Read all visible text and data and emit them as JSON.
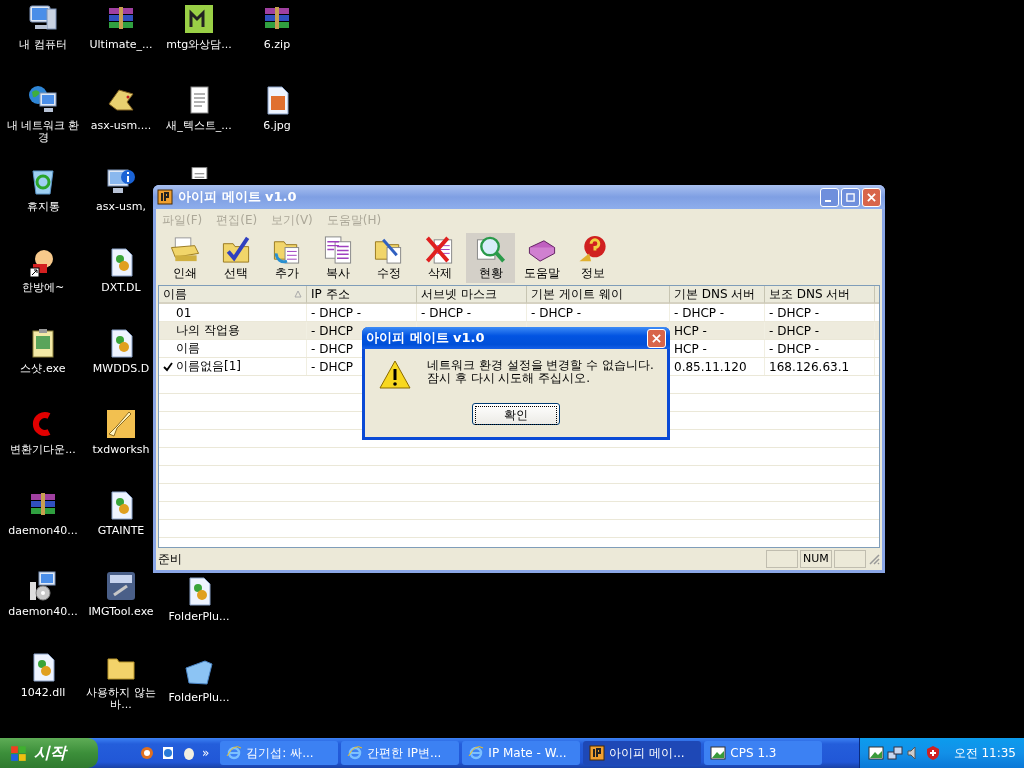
{
  "desktop": {
    "columns": [
      {
        "groups": [
          [
            {
              "label": "내 컴퓨터",
              "kind": "computer"
            },
            {
              "label": "내 네트워크 환경",
              "kind": "network"
            },
            {
              "label": "휴지통",
              "kind": "recycle"
            },
            {
              "label": "한방에~",
              "kind": "character"
            },
            {
              "label": "스샷.exe",
              "kind": "clipboard"
            },
            {
              "label": "변환기다운...",
              "kind": "letter"
            },
            {
              "label": "daemon40...",
              "kind": "archive"
            },
            {
              "label": "daemon40...",
              "kind": "installer"
            },
            {
              "label": "1042.dll",
              "kind": "dll"
            }
          ]
        ]
      },
      {
        "groups": [
          [
            {
              "label": "Ultimate_...",
              "kind": "archive"
            },
            {
              "label": "asx-usm....",
              "kind": "creature"
            },
            {
              "label": "asx-usm,",
              "kind": "info"
            },
            {
              "label": "DXT.DL",
              "kind": "dll"
            },
            {
              "label": "MWDDS.D",
              "kind": "dll"
            },
            {
              "label": "txdworksh",
              "kind": "brush"
            },
            {
              "label": "GTAINTE",
              "kind": "dll"
            },
            {
              "label": "IMGTool.exe",
              "kind": "tool"
            },
            {
              "label": "사용하지 않는 바...",
              "kind": "folder"
            }
          ]
        ]
      },
      {
        "groups": [
          [
            {
              "label": "mtg와상담...",
              "kind": "app"
            },
            {
              "label": "새_텍스트_...",
              "kind": "text"
            },
            {
              "kind": "text"
            }
          ],
          [
            {
              "label": "FolderPlu...",
              "kind": "dll"
            },
            {
              "label": "FolderPlu...",
              "kind": "bluefolder"
            }
          ]
        ]
      },
      {
        "groups": [
          [
            {
              "label": "6.zip",
              "kind": "archive"
            },
            {
              "label": "6.jpg",
              "kind": "image"
            }
          ]
        ]
      }
    ]
  },
  "window": {
    "title": "아이피 메이트 v1.0",
    "menu": [
      {
        "label": "파일(F)",
        "disabled": true
      },
      {
        "label": "편집(E)",
        "disabled": true
      },
      {
        "label": "보기(V)",
        "disabled": true
      },
      {
        "label": "도움말(H)",
        "disabled": true
      }
    ],
    "toolbar": [
      {
        "label": "인쇄",
        "kind": "print",
        "selected": false
      },
      {
        "label": "선택",
        "kind": "select",
        "selected": false
      },
      {
        "label": "추가",
        "kind": "add",
        "selected": false
      },
      {
        "label": "복사",
        "kind": "copy",
        "selected": false
      },
      {
        "label": "수정",
        "kind": "edit",
        "selected": false
      },
      {
        "label": "삭제",
        "kind": "delete",
        "selected": false
      },
      {
        "label": "현황",
        "kind": "status",
        "selected": true
      },
      {
        "label": "도움말",
        "kind": "help",
        "selected": false
      },
      {
        "label": "정보",
        "kind": "info",
        "selected": false
      }
    ],
    "table": {
      "columns": [
        {
          "label": "이름",
          "sorted": true
        },
        {
          "label": "IP 주소",
          "sorted": false
        },
        {
          "label": "서브넷 마스크",
          "sorted": false
        },
        {
          "label": "기본 게이트 웨이",
          "sorted": false
        },
        {
          "label": "기본 DNS 서버",
          "sorted": false
        },
        {
          "label": "보조 DNS 서버",
          "sorted": false
        }
      ],
      "rows": [
        {
          "checked": false,
          "selected": false,
          "cells": [
            "01",
            "- DHCP -",
            "- DHCP -",
            "- DHCP -",
            "- DHCP -",
            "- DHCP -"
          ]
        },
        {
          "checked": false,
          "selected": true,
          "cells": [
            "나의 작업용",
            "- DHCP",
            null,
            null,
            "HCP -",
            "- DHCP -"
          ]
        },
        {
          "checked": false,
          "selected": false,
          "cells": [
            "이름",
            "- DHCP",
            null,
            null,
            "HCP -",
            "- DHCP -"
          ]
        },
        {
          "checked": true,
          "selected": false,
          "cells": [
            "이름없음[1]",
            "- DHCP",
            null,
            null,
            "0.85.11.120",
            "168.126.63.1"
          ]
        }
      ]
    },
    "status_bar": {
      "text": "준비",
      "indicators": [
        "NUM"
      ]
    }
  },
  "dialog": {
    "title": "아이피 메이트 v1.0",
    "kind": "warning",
    "message": "네트워크 환경 설정을 변경할 수 없습니다.\n잠시 후 다시 시도해 주십시오.",
    "button": "확인"
  },
  "taskbar": {
    "start": "시작",
    "chevron": "»",
    "tasks": [
      {
        "label": "김기섭: 싸...",
        "kind": "browser",
        "selected": false
      },
      {
        "label": "간편한 IP변...",
        "kind": "browser",
        "selected": false
      },
      {
        "label": "IP Mate - W...",
        "kind": "browser",
        "selected": false
      },
      {
        "label": "아이피 메이...",
        "kind": "app",
        "selected": true
      },
      {
        "label": "CPS 1.3",
        "kind": "image",
        "selected": false
      }
    ],
    "clock": "오전 11:35"
  }
}
